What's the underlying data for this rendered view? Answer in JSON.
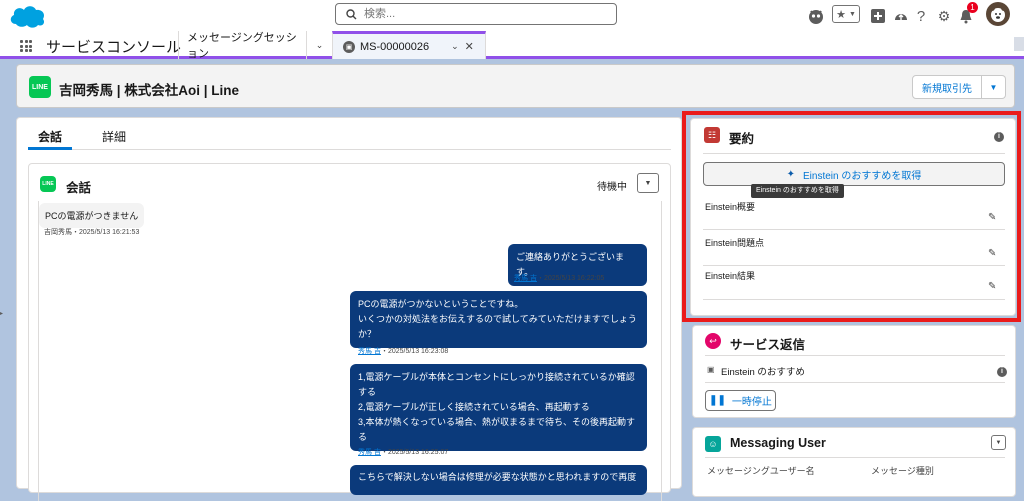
{
  "global_header": {
    "search": {
      "placeholder": "検索...",
      "value": ""
    },
    "notification_count": "1"
  },
  "nav": {
    "app_name": "サービスコンソール",
    "tabs": [
      {
        "label": "メッセージングセッション"
      },
      {
        "label": "MS-00000026"
      }
    ]
  },
  "record": {
    "title": "吉岡秀馬 | 株式会社Aoi | Line",
    "line_badge": "LINE",
    "new_deal_button": "新規取引先"
  },
  "left": {
    "tabs": [
      {
        "label": "会話"
      },
      {
        "label": "詳細"
      }
    ],
    "conversation": {
      "title": "会話",
      "status": "待機中",
      "messages": [
        {
          "direction": "in",
          "text": "PCの電源がつきません",
          "sender": "吉岡秀馬",
          "time": "・2025/5/13 16:21:53"
        },
        {
          "direction": "out",
          "text": "ご連絡ありがとうございます。",
          "sender": "秀馬 吉",
          "time": "・2025/5/13 16:22:05"
        },
        {
          "direction": "out",
          "lines": [
            "PCの電源がつかないということですね。",
            "いくつかの対処法をお伝えするので試してみていただけますでしょうか？"
          ],
          "sender": "秀馬 吉",
          "time": "・2025/5/13 16:23:08"
        },
        {
          "direction": "out",
          "lines": [
            "1,電源ケーブルが本体とコンセントにしっかり接続されているか確認する",
            "2,電源ケーブルが正しく接続されている場合、再起動する",
            "3,本体が熱くなっている場合、熱が収まるまで待ち、その後再起動する"
          ],
          "sender": "秀馬 吉",
          "time": "・2025/5/13 16:25:07"
        },
        {
          "direction": "out",
          "text": "こちらで解決しない場合は修理が必要な状態かと思われますので再度"
        }
      ]
    }
  },
  "summary": {
    "title": "要約",
    "einstein_button": "Einstein のおすすめを取得",
    "tooltip": "Einstein のおすすめを取得",
    "fields": [
      {
        "label": "Einstein概要"
      },
      {
        "label": "Einstein問題点"
      },
      {
        "label": "Einstein結果"
      }
    ]
  },
  "service_reply": {
    "title": "サービス返信",
    "recommend_label": "Einstein のおすすめ",
    "pause_button": "一時停止"
  },
  "messaging_user": {
    "title": "Messaging User",
    "field1_label": "メッセージングユーザー名",
    "field2_label": "メッセージ種別"
  },
  "colors": {
    "brand": "#0176d3",
    "accent_purple": "#9050e9",
    "message_bubble": "#0b3a7b",
    "highlight_frame": "#ea1b1b"
  }
}
